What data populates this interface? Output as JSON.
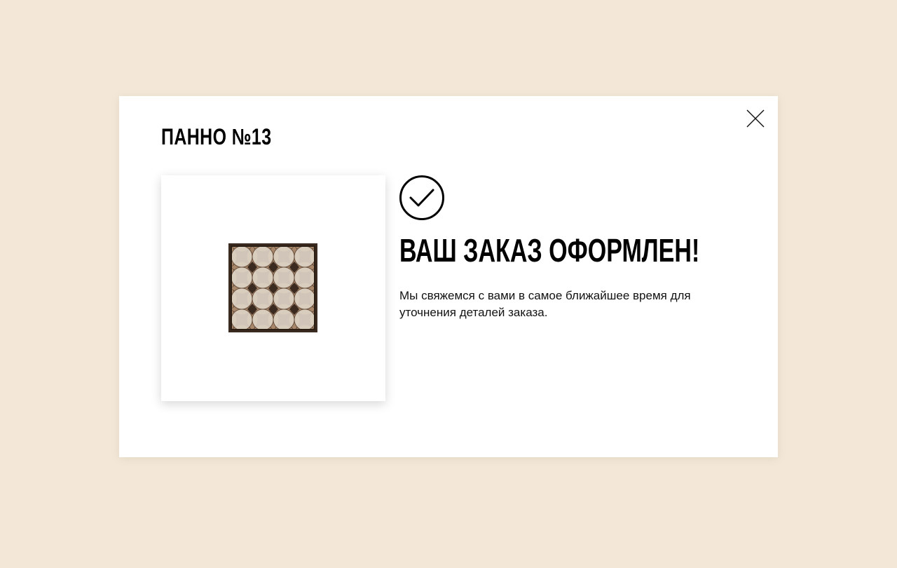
{
  "modal": {
    "product_title": "ПАННО №13",
    "close_icon": "close-icon",
    "image": {
      "alt": "Панно №13",
      "icon": "mosaic-tile-image"
    },
    "success_icon": "check-circle-icon",
    "success_heading": "ВАШ ЗАКАЗ ОФОРМЛЕН!",
    "success_message": "Мы свяжемся с вами в самое ближайшее время для уточнения деталей заказа."
  },
  "colors": {
    "page_background": "#f3e8d8",
    "modal_background": "#ffffff",
    "text": "#000000",
    "tile_dark": "#3b2a1f",
    "tile_light": "#ddd3c6",
    "tile_mid": "#a8876a"
  }
}
